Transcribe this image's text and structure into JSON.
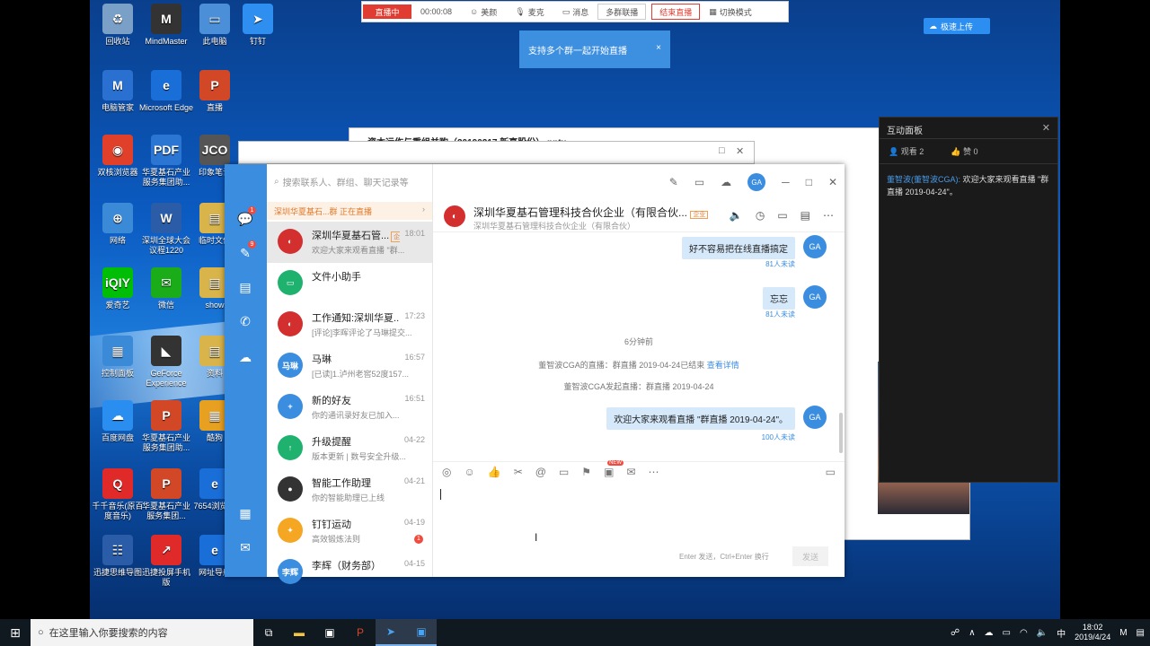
{
  "live_bar": {
    "status": "直播中",
    "elapsed": "00:00:08",
    "beauty": "美颜",
    "mic": "麦克",
    "messages": "消息",
    "multi": "多群联播",
    "end": "结束直播",
    "switch_mode": "切换模式"
  },
  "tooltip": {
    "text": "支持多个群一起开始直播",
    "close": "×"
  },
  "upload_button": "极速上传",
  "desktop_icons": [
    {
      "label": "回收站",
      "color": "#7aa0c8",
      "glyph": "♻"
    },
    {
      "label": "MindMaster",
      "color": "#333333",
      "glyph": "M"
    },
    {
      "label": "此电脑",
      "color": "#4a8fd8",
      "glyph": "▭"
    },
    {
      "label": "钉钉",
      "color": "#2e8ff0",
      "glyph": "➤"
    },
    {
      "label": "电脑管家",
      "color": "#2a70d0",
      "glyph": "M"
    },
    {
      "label": "Microsoft Edge",
      "color": "#1a6ed8",
      "glyph": "e"
    },
    {
      "label": "直播",
      "color": "#d24726",
      "glyph": "P"
    },
    {
      "label": "双核浏览器",
      "color": "#e0402a",
      "glyph": "◉"
    },
    {
      "label": "华夏基石产业服务集团助...",
      "color": "#2b76d2",
      "glyph": "PDF"
    },
    {
      "label": "印象笔记",
      "color": "#555555",
      "glyph": "JCO"
    },
    {
      "label": "网络",
      "color": "#3a8ad8",
      "glyph": "⊕"
    },
    {
      "label": "深圳全球大会议程1220",
      "color": "#2a5ca8",
      "glyph": "W"
    },
    {
      "label": "临时文件",
      "color": "#d9b44a",
      "glyph": "▤"
    },
    {
      "label": "爱奇艺",
      "color": "#00be06",
      "glyph": "iQIY"
    },
    {
      "label": "微信",
      "color": "#1aad19",
      "glyph": "✉"
    },
    {
      "label": "show",
      "color": "#d9b44a",
      "glyph": "▤"
    },
    {
      "label": "控制面板",
      "color": "#3a8ad8",
      "glyph": "▦"
    },
    {
      "label": "GeForce Experience",
      "color": "#333333",
      "glyph": "◣"
    },
    {
      "label": "资料",
      "color": "#d9b44a",
      "glyph": "▤"
    },
    {
      "label": "百度网盘",
      "color": "#2a8ef0",
      "glyph": "☁"
    },
    {
      "label": "华夏基石产业服务集团助...",
      "color": "#d24726",
      "glyph": "P"
    },
    {
      "label": "酷狗",
      "color": "#e8a020",
      "glyph": "▦"
    },
    {
      "label": "千千音乐(原百度音乐)",
      "color": "#e02a2a",
      "glyph": "Q"
    },
    {
      "label": "华夏基石产业服务集团...",
      "color": "#d24726",
      "glyph": "P"
    },
    {
      "label": "7654浏览器",
      "color": "#1a6ed8",
      "glyph": "e"
    },
    {
      "label": "迅捷思维导图",
      "color": "#2a5ca8",
      "glyph": "☷"
    },
    {
      "label": "迅捷投屏手机版",
      "color": "#e02a2a",
      "glyph": "↗"
    },
    {
      "label": "网址导航",
      "color": "#1a6ed8",
      "glyph": "e"
    }
  ],
  "ppt_window": {
    "title": "资本运作与重组并购（20190217 新高股份）.pptx"
  },
  "chat": {
    "search_placeholder": "搜索联系人、群组、聊天记录等",
    "avatar": "GA",
    "live_banner": "深圳华夏基石...群 正在直播",
    "nav_badges": [
      "1",
      "9"
    ],
    "conversations": [
      {
        "name": "深圳华夏基石管...",
        "tag": "企业",
        "time": "18:01",
        "preview": "欢迎大家来观看直播 \"群...",
        "avatar_color": "#d42f2f",
        "avatar_text": "◐",
        "active": true
      },
      {
        "name": "文件小助手",
        "tag": "",
        "time": "",
        "preview": "",
        "avatar_color": "#1fb26e",
        "avatar_text": "▭",
        "active": false
      },
      {
        "name": "工作通知:深圳华夏...",
        "tag": "",
        "time": "17:23",
        "preview": "[评论]李晖评论了马琳提交...",
        "avatar_color": "#d42f2f",
        "avatar_text": "◐",
        "active": false
      },
      {
        "name": "马琳",
        "tag": "",
        "time": "16:57",
        "preview": "[已读]1.泸州老窖52度157...",
        "avatar_color": "#3b8de0",
        "avatar_text": "马琳",
        "active": false
      },
      {
        "name": "新的好友",
        "tag": "",
        "time": "16:51",
        "preview": "你的通讯录好友已加入...",
        "avatar_color": "#3b8de0",
        "avatar_text": "+",
        "active": false
      },
      {
        "name": "升级提醒",
        "tag": "",
        "time": "04-22",
        "preview": "版本更新 | 数号安全升级...",
        "avatar_color": "#1fb26e",
        "avatar_text": "↑",
        "active": false
      },
      {
        "name": "智能工作助理",
        "tag": "",
        "time": "04-21",
        "preview": "你的智能助理已上线",
        "avatar_color": "#333333",
        "avatar_text": "●",
        "active": false
      },
      {
        "name": "钉钉运动",
        "tag": "",
        "time": "04-19",
        "preview": "高效锻炼法则",
        "avatar_color": "#f5a623",
        "avatar_text": "✦",
        "active": false,
        "badge": "1"
      },
      {
        "name": "李辉（财务部）",
        "tag": "",
        "time": "04-15",
        "preview": "",
        "avatar_color": "#3b8de0",
        "avatar_text": "李辉",
        "active": false
      }
    ],
    "header": {
      "title": "深圳华夏基石管理科技合伙企业（有限合伙...",
      "tag": "企业",
      "subtitle": "深圳华夏基石管理科技合伙企业（有限合伙）"
    },
    "messages": [
      {
        "text": "好不容易把在线直播搞定",
        "unread": "81人未读"
      },
      {
        "text": "忘忘",
        "unread": "81人未读"
      }
    ],
    "time_divider": "6分钟前",
    "system": [
      {
        "text": "董智波CGA的直播：群直播 2019-04-24已结束",
        "link": "查看详情"
      },
      {
        "text": "董智波CGA发起直播：群直播 2019-04-24",
        "link": ""
      }
    ],
    "last_message": {
      "text": "欢迎大家来观看直播 \"群直播 2019-04-24\"。",
      "unread": "100人未读"
    },
    "send_hint": "Enter 发送，Ctrl+Enter 换行",
    "send_button": "发送",
    "new_badge": "NEW"
  },
  "panel": {
    "title": "互动面板",
    "views": "观看 2",
    "likes": "赞 0",
    "message_user": "董智波(董智波CGA):",
    "message_text": "欢迎大家来观看直播 \"群直播 2019-04-24\"。"
  },
  "taskbar": {
    "search_placeholder": "在这里输入你要搜索的内容",
    "time": "18:02",
    "date": "2019/4/24",
    "ime": "中"
  }
}
